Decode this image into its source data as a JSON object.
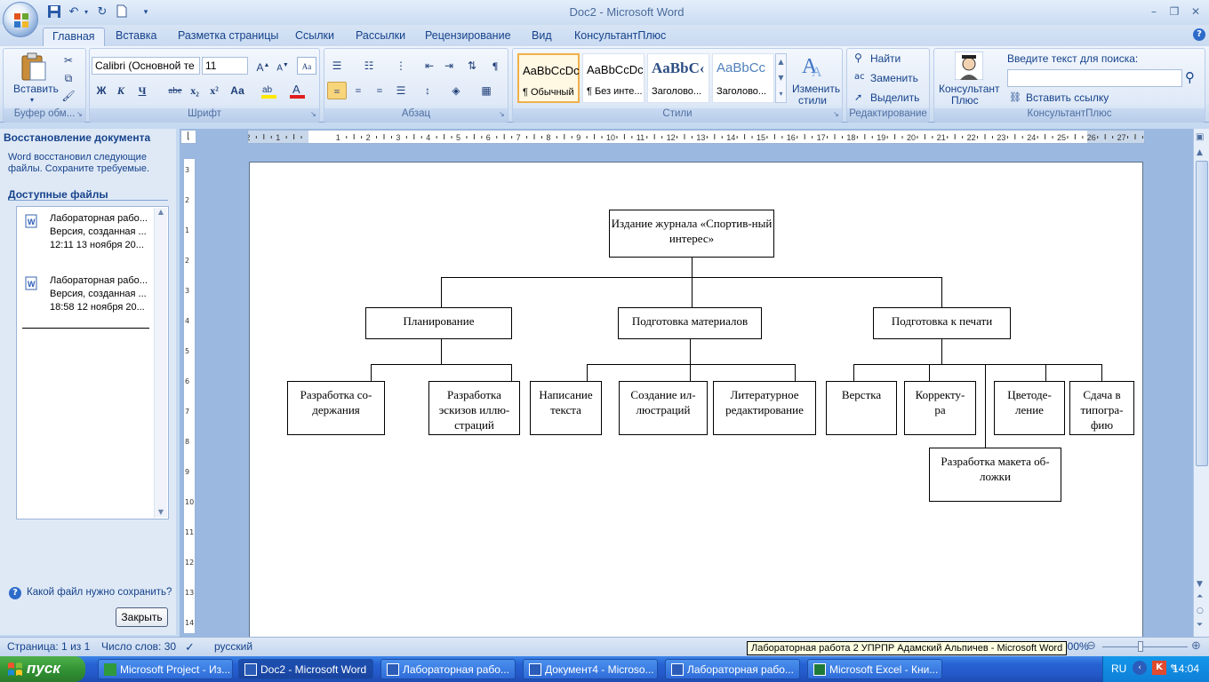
{
  "window": {
    "title": "Doc2 - Microsoft Word",
    "min": "–",
    "max": "❐",
    "close": "✕"
  },
  "tabs": [
    "Главная",
    "Вставка",
    "Разметка страницы",
    "Ссылки",
    "Рассылки",
    "Рецензирование",
    "Вид",
    "КонсультантПлюс"
  ],
  "ribbon": {
    "clipboard": {
      "paste": "Вставить",
      "label": "Буфер обм..."
    },
    "font": {
      "family": "Calibri (Основной те",
      "size": "11",
      "label": "Шрифт",
      "bold": "Ж",
      "italic": "К",
      "underline": "Ч",
      "strike": "abe",
      "sub": "x₂",
      "sup": "x²",
      "case": "Аа"
    },
    "paragraph": {
      "label": "Абзац"
    },
    "styles": {
      "label": "Стили",
      "items": [
        {
          "preview": "AaBbCcDc",
          "name": "¶ Обычный"
        },
        {
          "preview": "AaBbCcDc",
          "name": "¶ Без инте..."
        },
        {
          "preview": "AaBbC‹",
          "name": "Заголово..."
        },
        {
          "preview": "AaBbCc",
          "name": "Заголово..."
        }
      ],
      "change": "Изменить",
      "change2": "стили"
    },
    "editing": {
      "label": "Редактирование",
      "find": "Найти",
      "replace": "Заменить",
      "select": "Выделить"
    },
    "consultant": {
      "label": "КонсультантПлюс",
      "btn1": "Консультант",
      "btn2": "Плюс",
      "search_label": "Введите текст для поиска:",
      "insert_link": "Вставить ссылку"
    }
  },
  "taskpane": {
    "title": "Восстановление документа",
    "desc": "Word восстановил следующие файлы.  Сохраните требуемые.",
    "files_header": "Доступные файлы",
    "files": [
      {
        "name": "Лабораторная рабо...",
        "version": "Версия, созданная ...",
        "time": "12:11 13 ноября 20..."
      },
      {
        "name": "Лабораторная рабо...",
        "version": "Версия, созданная ...",
        "time": "18:58 12 ноября 20..."
      }
    ],
    "help": "Какой файл нужно сохранить?",
    "close": "Закрыть"
  },
  "orgchart": {
    "root": "Издание журнала «Спортив-ный интерес»",
    "level1": [
      "Планирование",
      "Подготовка материалов",
      "Подготовка к печати"
    ],
    "level2": [
      "Разработка со-держания",
      "Разработка эскизов иллю-страций",
      "Написание текста",
      "Создание ил-люстраций",
      "Литературное редактирование",
      "Верстка",
      "Корректу-ра",
      "Цветоде-ление",
      "Сдача в типогра-фию",
      "Разработка макета об-ложки"
    ]
  },
  "status": {
    "page": "Страница: 1 из 1",
    "words": "Число слов: 30",
    "lang": "русский",
    "zoom": "100%",
    "tooltip": "Лабораторная работа 2 УПРПР Адамский Альпичев - Microsoft Word"
  },
  "taskbar": {
    "start": "пуск",
    "tasks": [
      "Microsoft Project - Из...",
      "Doc2 - Microsoft Word",
      "Лабораторная рабо...",
      "Документ4 - Microso...",
      "Лабораторная рабо...",
      "Microsoft Excel - Кни..."
    ],
    "lang": "RU",
    "clock": "14:04"
  }
}
